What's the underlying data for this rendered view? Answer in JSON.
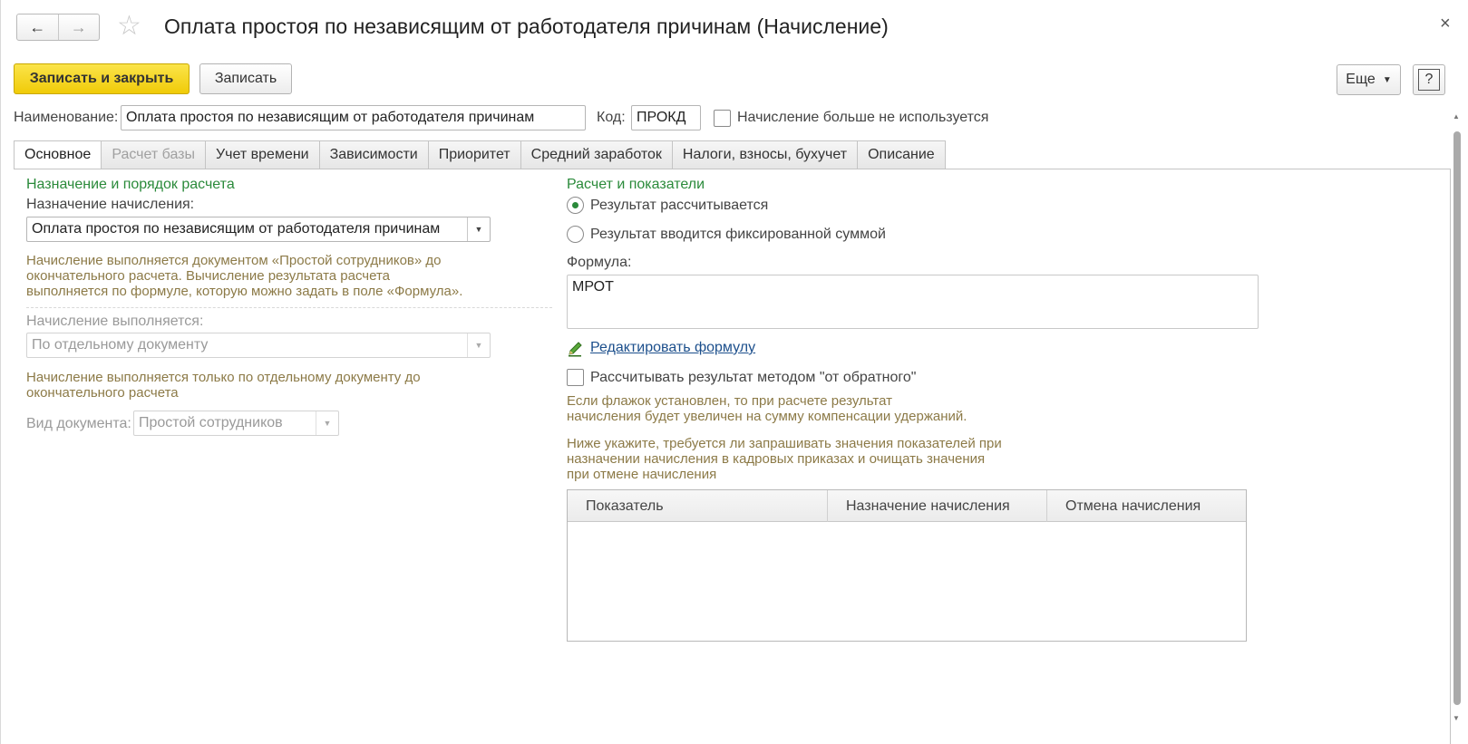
{
  "window": {
    "title": "Оплата простоя по независящим от работодателя причинам (Начисление)",
    "back_icon": "←",
    "forward_icon": "→",
    "star_icon": "☆",
    "close_icon": "×"
  },
  "toolbar": {
    "save_close_label": "Записать и закрыть",
    "save_label": "Записать",
    "more_label": "Еще",
    "more_caret": "▼",
    "help_label": "?"
  },
  "header": {
    "name_label": "Наименование:",
    "name_value": "Оплата простоя по независящим от работодателя причинам",
    "code_label": "Код:",
    "code_value": "ПРОКД",
    "unused_label": "Начисление больше не используется"
  },
  "tabs": [
    {
      "label": "Основное"
    },
    {
      "label": "Расчет базы"
    },
    {
      "label": "Учет времени"
    },
    {
      "label": "Зависимости"
    },
    {
      "label": "Приоритет"
    },
    {
      "label": "Средний заработок"
    },
    {
      "label": "Налоги, взносы, бухучет"
    },
    {
      "label": "Описание"
    }
  ],
  "left": {
    "section_title": "Назначение и порядок расчета",
    "purpose_label": "Назначение начисления:",
    "purpose_value": "Оплата простоя по независящим от работодателя причинам",
    "purpose_hint_1": "Начисление выполняется документом «Простой сотрудников» до",
    "purpose_hint_2": "окончательного расчета. Вычисление результата расчета",
    "purpose_hint_3": "выполняется по формуле, которую можно задать в поле «Формула».",
    "performed_label": "Начисление выполняется:",
    "performed_value": "По отдельному документу",
    "performed_hint_1": "Начисление выполняется только по отдельному документу до",
    "performed_hint_2": "окончательного расчета",
    "doc_type_label": "Вид документа:",
    "doc_type_value": "Простой сотрудников"
  },
  "right": {
    "section_title": "Расчет и показатели",
    "radio_calculated": "Результат рассчитывается",
    "radio_fixed": "Результат вводится фиксированной суммой",
    "formula_label": "Формула:",
    "formula_value": "МРОТ",
    "edit_formula_link": "Редактировать формулу",
    "reverse_label": "Рассчитывать результат методом \"от обратного\"",
    "reverse_hint_1": "Если флажок установлен, то при расчете результат",
    "reverse_hint_2": "начисления будет увеличен на сумму компенсации удержаний.",
    "indicators_hint_1": "Ниже укажите, требуется ли запрашивать значения показателей при",
    "indicators_hint_2": "назначении начисления в кадровых приказах и очищать значения",
    "indicators_hint_3": "при отмене начисления",
    "table_headers": [
      "Показатель",
      "Назначение начисления",
      "Отмена начисления"
    ]
  }
}
